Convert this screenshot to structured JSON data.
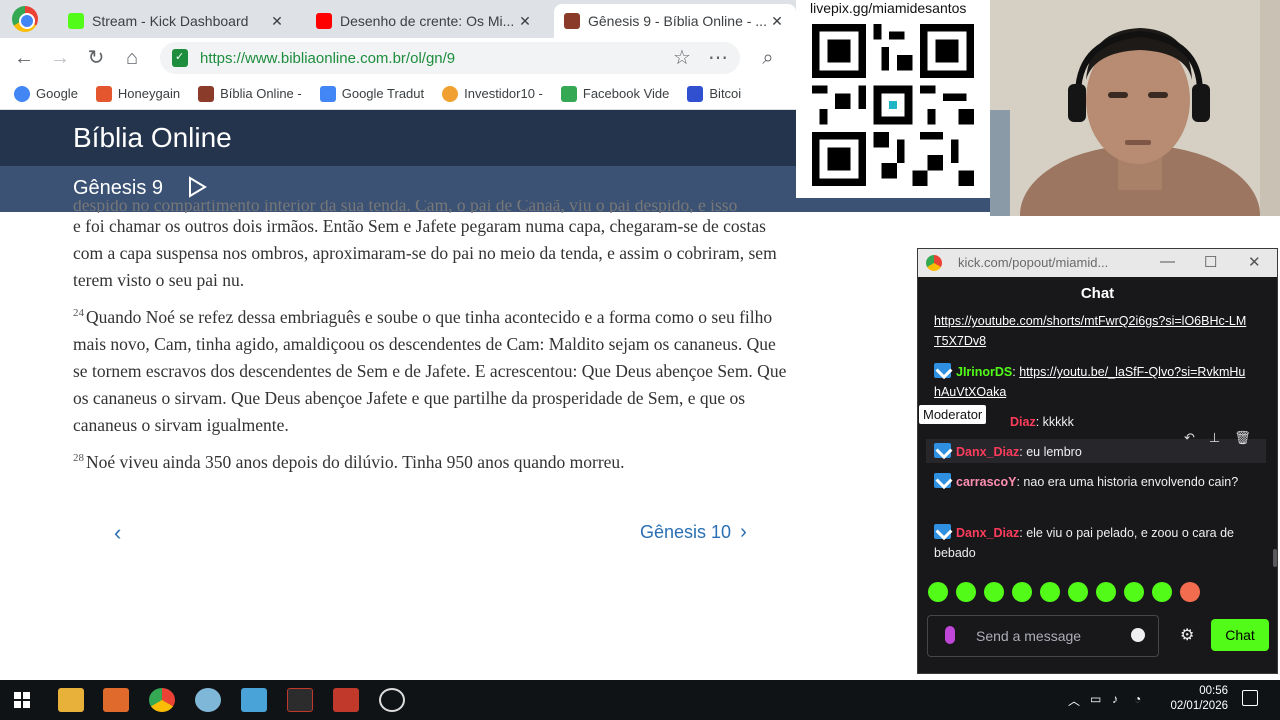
{
  "browser": {
    "tabs": [
      {
        "title": "Stream - Kick Dashboard",
        "color": "#53fc18",
        "active": false
      },
      {
        "title": "Desenho de crente: Os Mi...",
        "color": "#ff0000",
        "active": false
      },
      {
        "title": "Gênesis 9 - Bíblia Online - ...",
        "color": "#8a3b2a",
        "active": true
      }
    ],
    "url": "https://www.bibliaonline.com.br/ol/gn/9",
    "bookmarks": [
      "Google",
      "Honeygain",
      "Bíblia Online -",
      "Google Tradut",
      "Investidor10 -",
      "Facebook Vide",
      "Bitcoi"
    ]
  },
  "site": {
    "title": "Bíblia Online",
    "chapter": "Gênesis 9",
    "faded_line": "despido no compartimento interior da sua tenda. Cam, o pai de Canaã, viu o pai despido, e isso",
    "verses": [
      {
        "num": "",
        "text": "e foi chamar os outros dois irmãos. Então Sem e Jafete pegaram numa capa, chegaram-se de costas com a capa suspensa nos ombros, aproximaram-se do pai no meio da tenda, e assim o cobriram, sem terem visto o seu pai nu."
      },
      {
        "num": "24",
        "text": "Quando Noé se refez dessa embriaguês e soube o que tinha acontecido e a forma como o seu filho mais novo, Cam, tinha agido, amaldiçoou os descendentes de Cam: Maldito sejam os cananeus. Que se tornem escravos dos descendentes de Sem e de Jafete. E acrescentou: Que Deus abençoe Sem. Que os cananeus o sirvam. Que Deus abençoe Jafete e que partilhe da prosperidade de Sem, e que os cananeus o sirvam igualmente."
      },
      {
        "num": "28",
        "text": "Noé viveu ainda 350 anos depois do dilúvio. Tinha 950 anos quando morreu."
      }
    ],
    "prev_label": "‹",
    "next_label": "Gênesis 10"
  },
  "overlay": {
    "qr_label": "livepix.gg/miamidesantos"
  },
  "chat": {
    "window_title": "kick.com/popout/miamid...",
    "header": "Chat",
    "messages": [
      {
        "user": "",
        "color": "",
        "text": "https://youtube.com/shorts/mtFwrQ2i6gs?si=lO6BHc-LMT5X7Dv8",
        "link": true
      },
      {
        "user": "JIrinorDS",
        "color": "green",
        "text": "https://youtu.be/_laSfF-Qlvo?si=RvkmHuhAuVtXOaka",
        "link": true
      },
      {
        "user": "Diaz",
        "color": "red",
        "text": "kkkkk",
        "link": false
      },
      {
        "user": "Danx_Diaz",
        "color": "red",
        "text": "eu lembro",
        "link": false
      },
      {
        "user": "carrascoY",
        "color": "pink",
        "text": "nao era uma historia envolvendo cain?",
        "link": false
      },
      {
        "user": "Danx_Diaz",
        "color": "red",
        "text": "ele viu o pai pelado, e zoou o cara de bebado",
        "link": false
      }
    ],
    "tooltip": "Moderator",
    "input_placeholder": "Send a message",
    "send_label": "Chat"
  },
  "taskbar": {
    "time": "00:56",
    "date": "02/01/2026"
  }
}
